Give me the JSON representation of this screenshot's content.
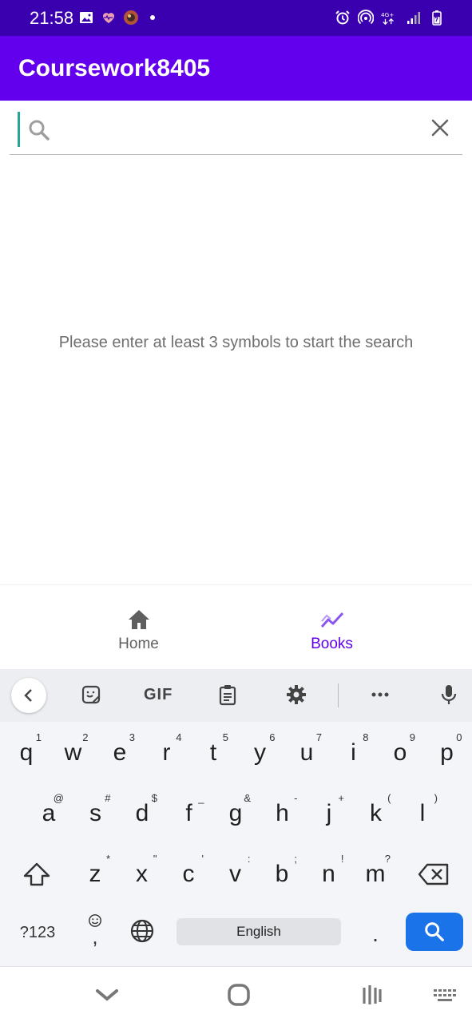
{
  "status_bar": {
    "time": "21:58",
    "left_icons": [
      "image-icon",
      "heart-icon",
      "avatar-icon"
    ],
    "right_icons": [
      "alarm-icon",
      "hotspot-icon",
      "network-4g-icon",
      "signal-icon",
      "battery-icon"
    ],
    "network_label": "4G+"
  },
  "app_bar": {
    "title": "Coursework8405"
  },
  "search": {
    "value": "",
    "placeholder": ""
  },
  "hint_text": "Please enter at least 3 symbols to start the search",
  "bottom_nav": {
    "items": [
      {
        "label": "Home",
        "icon": "home-icon",
        "active": false
      },
      {
        "label": "Books",
        "icon": "trending-icon",
        "active": true
      }
    ],
    "active_color": "#6200ee"
  },
  "keyboard": {
    "toolbar": [
      "back-icon",
      "sticker-icon",
      "GIF",
      "clipboard-icon",
      "settings-icon",
      "more-icon",
      "mic-icon"
    ],
    "row1": [
      {
        "k": "q",
        "s": "1"
      },
      {
        "k": "w",
        "s": "2"
      },
      {
        "k": "e",
        "s": "3"
      },
      {
        "k": "r",
        "s": "4"
      },
      {
        "k": "t",
        "s": "5"
      },
      {
        "k": "y",
        "s": "6"
      },
      {
        "k": "u",
        "s": "7"
      },
      {
        "k": "i",
        "s": "8"
      },
      {
        "k": "o",
        "s": "9"
      },
      {
        "k": "p",
        "s": "0"
      }
    ],
    "row2": [
      {
        "k": "a",
        "s": "@"
      },
      {
        "k": "s",
        "s": "#"
      },
      {
        "k": "d",
        "s": "$"
      },
      {
        "k": "f",
        "s": "_"
      },
      {
        "k": "g",
        "s": "&"
      },
      {
        "k": "h",
        "s": "-"
      },
      {
        "k": "j",
        "s": "+"
      },
      {
        "k": "k",
        "s": "("
      },
      {
        "k": "l",
        "s": ")"
      }
    ],
    "row3": [
      {
        "k": "z",
        "s": "*"
      },
      {
        "k": "x",
        "s": "\""
      },
      {
        "k": "c",
        "s": "'"
      },
      {
        "k": "v",
        "s": ":"
      },
      {
        "k": "b",
        "s": ";"
      },
      {
        "k": "n",
        "s": "!"
      },
      {
        "k": "m",
        "s": "?"
      }
    ],
    "symbols_label": "?123",
    "comma_label": ",",
    "space_label": "English",
    "period_label": ".",
    "search_key_color": "#1a73e8"
  },
  "colors": {
    "status_bar": "#3a00b0",
    "app_bar": "#6200ee",
    "caret": "#26a69a"
  }
}
